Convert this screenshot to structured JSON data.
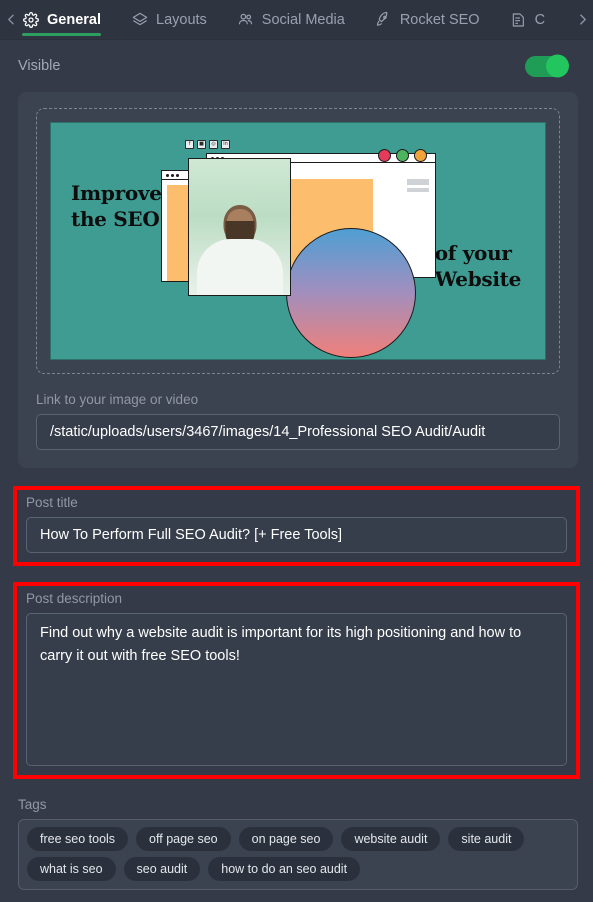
{
  "tabbar": {
    "prev_arrow": "chevron-left",
    "next_arrow": "chevron-right",
    "tabs": [
      {
        "label": "General",
        "icon": "gear-icon",
        "active": true
      },
      {
        "label": "Layouts",
        "icon": "layers-icon",
        "active": false
      },
      {
        "label": "Social Media",
        "icon": "users-icon",
        "active": false
      },
      {
        "label": "Rocket SEO",
        "icon": "rocket-icon",
        "active": false
      },
      {
        "label": "C",
        "icon": "document-icon",
        "active": false
      }
    ]
  },
  "visible": {
    "label": "Visible",
    "enabled": true,
    "toggle_color": "#22c55e"
  },
  "media": {
    "dropzone_name": "image-preview-dropzone",
    "artwork": {
      "heading_left_line1": "Improve",
      "heading_left_line2": "the SEO",
      "heading_right_line1": "of your",
      "heading_right_line2": "Website",
      "social_icons": [
        "f",
        "■",
        "◎",
        "in"
      ],
      "background_color": "#3f9c92",
      "panel_color": "#fcbe6c"
    },
    "link_label": "Link to your image or video",
    "link_value": "/static/uploads/users/3467/images/14_Professional SEO Audit/Audit"
  },
  "post_title": {
    "label": "Post title",
    "value": "How To Perform Full SEO Audit? [+ Free Tools]",
    "highlight_color": "#ff0000"
  },
  "post_description": {
    "label": "Post description",
    "value": "Find out why a website audit is important for its high positioning and how to carry it out with free SEO tools!",
    "highlight_color": "#ff0000"
  },
  "tags": {
    "label": "Tags",
    "items": [
      "free seo tools",
      "off page seo",
      "on page seo",
      "website audit",
      "site audit",
      "what is seo",
      "seo audit",
      "how to do an seo audit"
    ]
  }
}
